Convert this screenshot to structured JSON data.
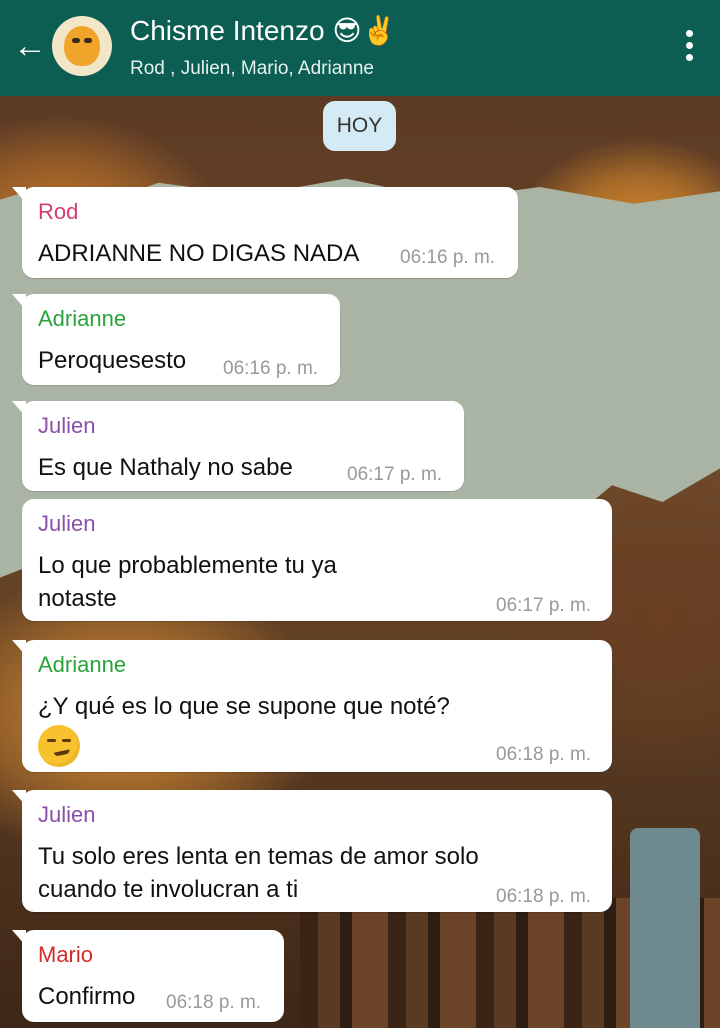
{
  "header": {
    "title": "Chisme Intenzo 😎✌️",
    "members": "Rod , Julien, Mario, Adrianne",
    "back_icon": "←"
  },
  "date_chip": "HOY",
  "colors": {
    "header_bg": "#0d5e52",
    "rod": "#d63b73",
    "adrianne": "#2aa33b",
    "julien": "#8a4fa8",
    "mario": "#d42b2b"
  },
  "messages": [
    {
      "sender": "Rod",
      "text": "ADRIANNE NO DIGAS NADA",
      "time": "06:16 p. m."
    },
    {
      "sender": "Adrianne",
      "text": "Peroquesesto",
      "time": "06:16 p. m."
    },
    {
      "sender": "Julien",
      "text": "Es que Nathaly no sabe",
      "time": "06:17 p. m."
    },
    {
      "sender": "Julien",
      "text_line1": "Lo que probablemente tu ya",
      "text_line2": "notaste",
      "time": "06:17 p. m."
    },
    {
      "sender": "Adrianne",
      "text": "¿Y qué es lo que se supone que noté?",
      "emoji": "smirking-face",
      "time": "06:18 p. m."
    },
    {
      "sender": "Julien",
      "text_line1": "Tu solo eres lenta en temas de amor solo",
      "text_line2": "cuando te involucran a ti",
      "time": "06:18 p. m."
    },
    {
      "sender": "Mario",
      "text": "Confirmo",
      "time": "06:18 p. m."
    }
  ]
}
